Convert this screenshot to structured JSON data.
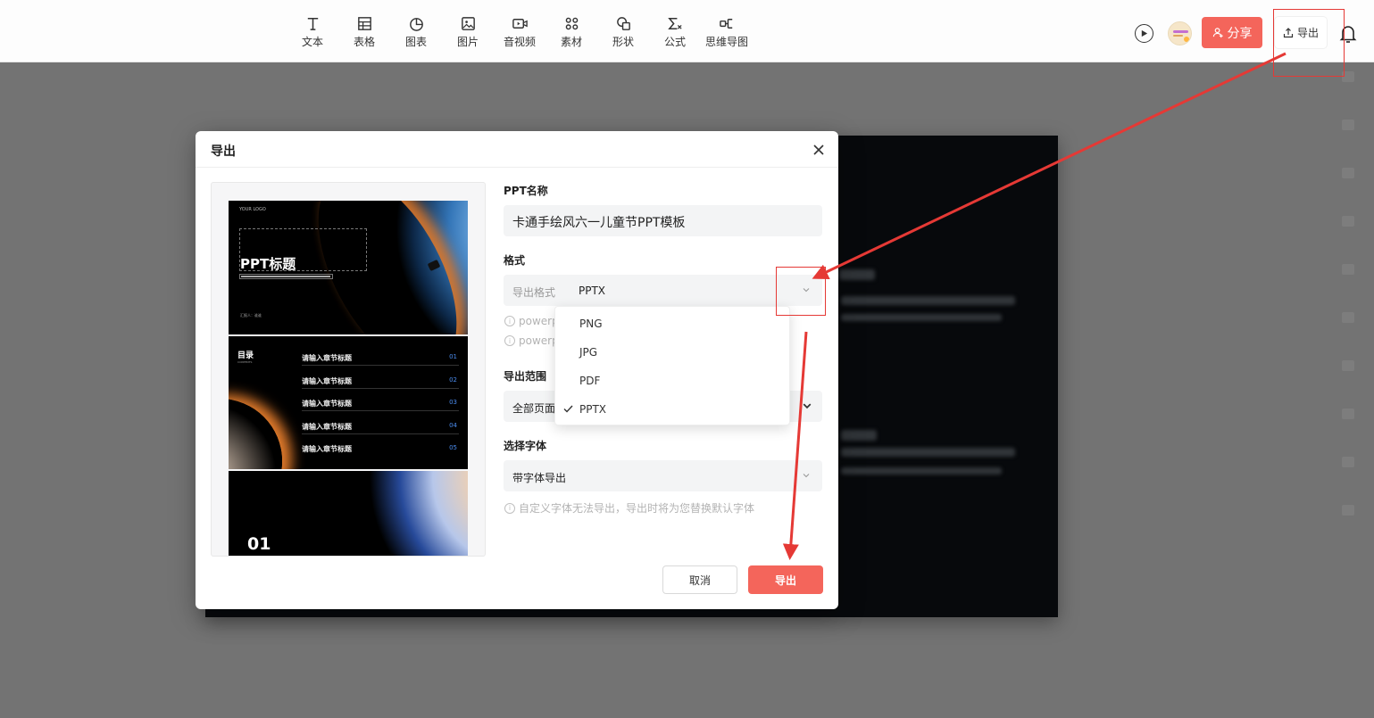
{
  "toolbar": {
    "tools": [
      {
        "label": "文本",
        "icon": "text-icon"
      },
      {
        "label": "表格",
        "icon": "table-icon"
      },
      {
        "label": "图表",
        "icon": "chart-icon"
      },
      {
        "label": "图片",
        "icon": "image-icon"
      },
      {
        "label": "音视频",
        "icon": "video-icon"
      },
      {
        "label": "素材",
        "icon": "material-icon"
      },
      {
        "label": "形状",
        "icon": "shape-icon"
      },
      {
        "label": "公式",
        "icon": "formula-icon"
      },
      {
        "label": "思维导图",
        "icon": "mindmap-icon"
      }
    ],
    "share_label": "分享",
    "export_label": "导出"
  },
  "modal": {
    "title": "导出",
    "preview": {
      "slide1_title": "PPT标题",
      "slide2_heading": "目录",
      "slide2_items": [
        {
          "title": "请输入章节标题",
          "num": "01"
        },
        {
          "title": "请输入章节标题",
          "num": "02"
        },
        {
          "title": "请输入章节标题",
          "num": "03"
        },
        {
          "title": "请输入章节标题",
          "num": "04"
        },
        {
          "title": "请输入章节标题",
          "num": "05"
        }
      ],
      "slide3_number": "01"
    },
    "name_label": "PPT名称",
    "name_value": "卡通手绘风六一儿童节PPT模板",
    "format_label": "格式",
    "format_field_label": "导出格式",
    "format_value": "PPTX",
    "format_hints": [
      "powerp",
      "powerp"
    ],
    "format_options": [
      {
        "label": "PNG",
        "selected": false
      },
      {
        "label": "JPG",
        "selected": false
      },
      {
        "label": "PDF",
        "selected": false
      },
      {
        "label": "PPTX",
        "selected": true
      }
    ],
    "range_label": "导出范围",
    "range_value": "全部页面",
    "font_label": "选择字体",
    "font_value": "带字体导出",
    "font_hint": "自定义字体无法导出，导出时将为您替换默认字体",
    "cancel_label": "取消",
    "export_label": "导出"
  },
  "colors": {
    "accent": "#f4655b",
    "annotation": "#e53935",
    "overlay": "#737373"
  }
}
